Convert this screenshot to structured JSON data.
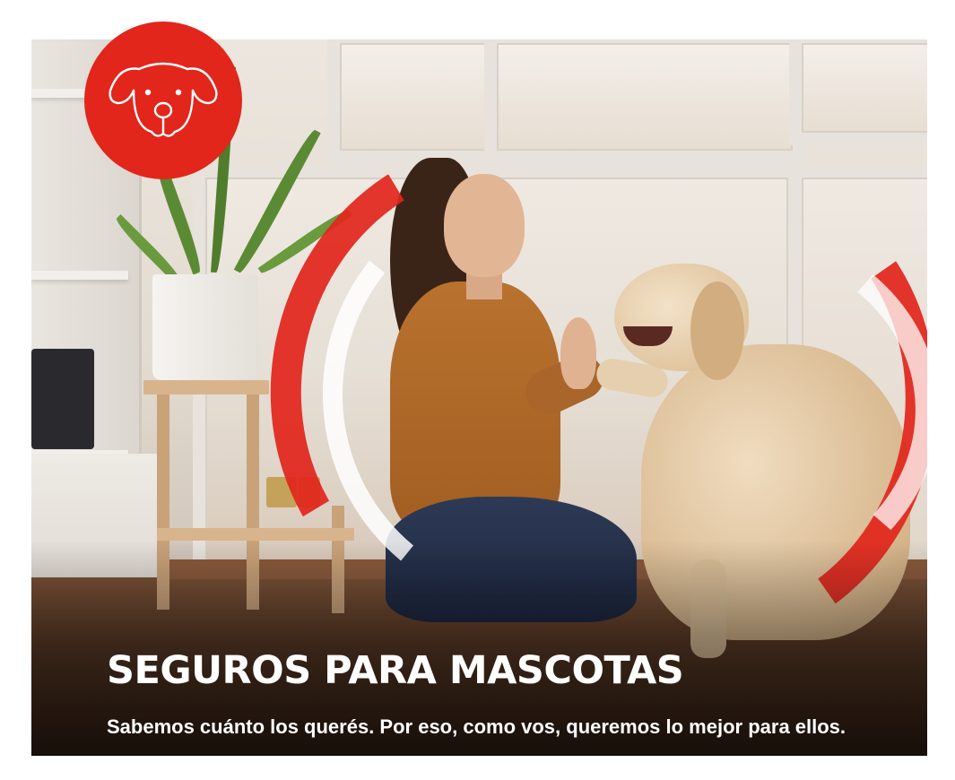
{
  "banner": {
    "title": "SEGUROS PARA MASCOTAS",
    "subtitle": "Sabemos cuánto los querés. Por eso, como vos, queremos lo mejor para ellos.",
    "badge_icon": "dog-face-icon",
    "photo": "woman-high-five-dog-photo"
  },
  "colors": {
    "brand_red": "#e2261c",
    "text": "#ffffff",
    "background": "#ffffff"
  }
}
